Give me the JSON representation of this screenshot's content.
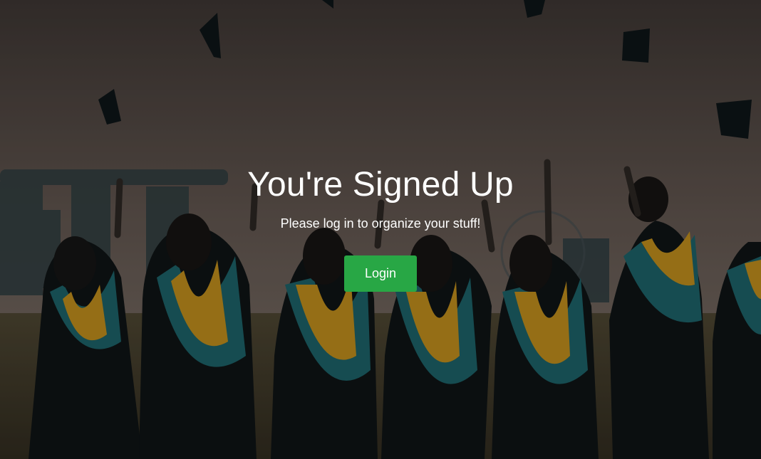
{
  "hero": {
    "title": "You're Signed Up",
    "subtitle": "Please log in to organize your stuff!",
    "login_label": "Login",
    "button_color": "#28a745",
    "background_image": "graduates-throwing-caps-photo"
  }
}
